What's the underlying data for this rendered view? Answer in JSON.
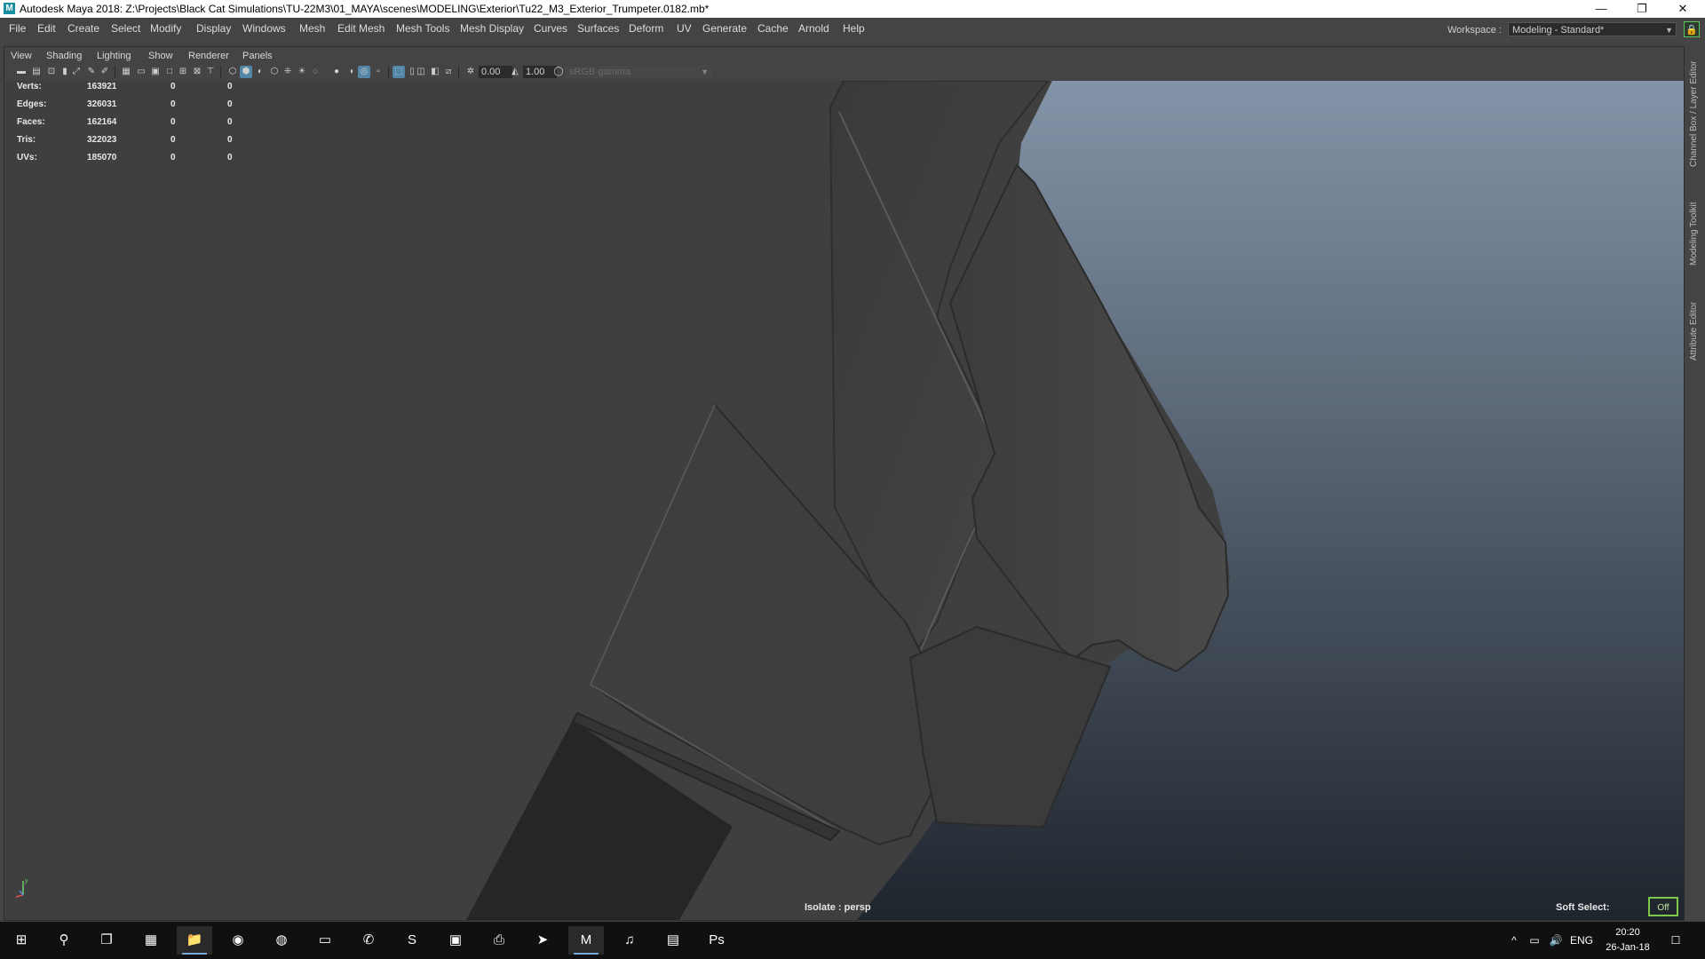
{
  "titlebar": {
    "title": "Autodesk Maya 2018: Z:\\Projects\\Black Cat Simulations\\TU-22M3\\01_MAYA\\scenes\\MODELING\\Exterior\\Tu22_M3_Exterior_Trumpeter.0182.mb*",
    "app_icon": "M",
    "minimize": "—",
    "restore": "❐",
    "close": "✕"
  },
  "menubar": {
    "items": [
      "File",
      "Edit",
      "Create",
      "Select",
      "Modify",
      "Display",
      "Windows",
      "Mesh",
      "Edit Mesh",
      "Mesh Tools",
      "Mesh Display",
      "Curves",
      "Surfaces",
      "Deform",
      "UV",
      "Generate",
      "Cache",
      "Arnold",
      "Help"
    ],
    "workspace_label": "Workspace :",
    "workspace_value": "Modeling - Standard*"
  },
  "panel": {
    "menu": [
      "View",
      "Shading",
      "Lighting",
      "Show",
      "Renderer",
      "Panels"
    ],
    "exposure": "0.00",
    "gamma": "1.00",
    "color_space": "sRGB gamma"
  },
  "hud": {
    "rows": [
      {
        "label": "Verts:",
        "v1": "163921",
        "v2": "0",
        "v3": "0"
      },
      {
        "label": "Edges:",
        "v1": "326031",
        "v2": "0",
        "v3": "0"
      },
      {
        "label": "Faces:",
        "v1": "162164",
        "v2": "0",
        "v3": "0"
      },
      {
        "label": "Tris:",
        "v1": "322023",
        "v2": "0",
        "v3": "0"
      },
      {
        "label": "UVs:",
        "v1": "185070",
        "v2": "0",
        "v3": "0"
      }
    ]
  },
  "viewport": {
    "isolate": "Isolate : persp",
    "soft_select": "Soft Select:",
    "soft_select_state": "Off",
    "axis_y": "y",
    "background_top": "#8394a8",
    "background_bottom": "#1f252d",
    "mesh_color": "#3f3f3f"
  },
  "right_dock": {
    "tabs": [
      "Channel Box / Layer Editor",
      "Modeling Toolkit",
      "Attribute Editor"
    ]
  },
  "taskbar": {
    "apps": [
      {
        "name": "start-icon",
        "glyph": "⊞"
      },
      {
        "name": "search-icon",
        "glyph": "⚲"
      },
      {
        "name": "task-view-icon",
        "glyph": "❐"
      },
      {
        "name": "store-icon",
        "glyph": "▦"
      },
      {
        "name": "file-explorer-icon",
        "glyph": "📁"
      },
      {
        "name": "firefox-icon",
        "glyph": "◉"
      },
      {
        "name": "chrome-icon",
        "glyph": "◍"
      },
      {
        "name": "camera-app-icon",
        "glyph": "▭"
      },
      {
        "name": "viber-icon",
        "glyph": "✆"
      },
      {
        "name": "skype-icon",
        "glyph": "S"
      },
      {
        "name": "game-app-icon",
        "glyph": "▣"
      },
      {
        "name": "printer-icon",
        "glyph": "⎙"
      },
      {
        "name": "telegram-icon",
        "glyph": "➤"
      },
      {
        "name": "maya-icon",
        "glyph": "M"
      },
      {
        "name": "itunes-icon",
        "glyph": "♫"
      },
      {
        "name": "photos-icon",
        "glyph": "▤"
      },
      {
        "name": "photoshop-icon",
        "glyph": "Ps"
      }
    ],
    "tray_chevron": "^",
    "tray_network": "▭",
    "tray_volume": "🔊",
    "language": "ENG",
    "time": "20:20",
    "date": "26-Jan-18",
    "notification": "☐"
  }
}
